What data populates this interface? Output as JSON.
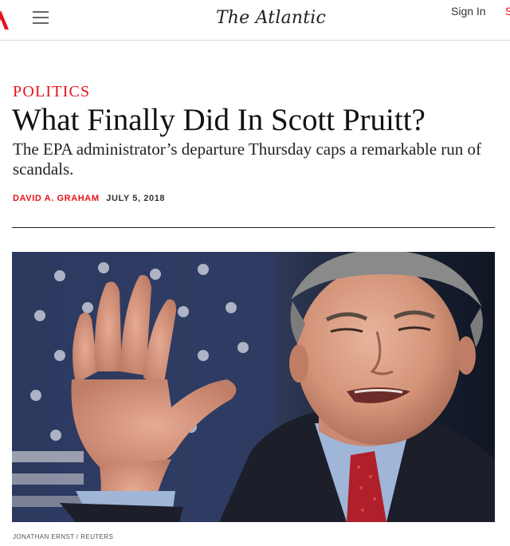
{
  "header": {
    "brand_wordmark": "The Atlantic",
    "sign_in_label": "Sign In",
    "subscribe_partial": "S",
    "menu_icon": "hamburger-menu-icon",
    "logo_icon": "atlantic-a-logo-icon"
  },
  "article": {
    "section": "POLITICS",
    "headline": "What Finally Did In Scott Pruitt?",
    "dek": "The EPA administrator’s departure Thursday caps a remarkable run of scandals.",
    "author": "DAVID A. GRAHAM",
    "date": "JULY 5, 2018"
  },
  "photo": {
    "credit": "JONATHAN ERNST / REUTERS"
  },
  "colors": {
    "accent_red": "#e7131a",
    "text_dark": "#111111",
    "rule": "#222222"
  }
}
